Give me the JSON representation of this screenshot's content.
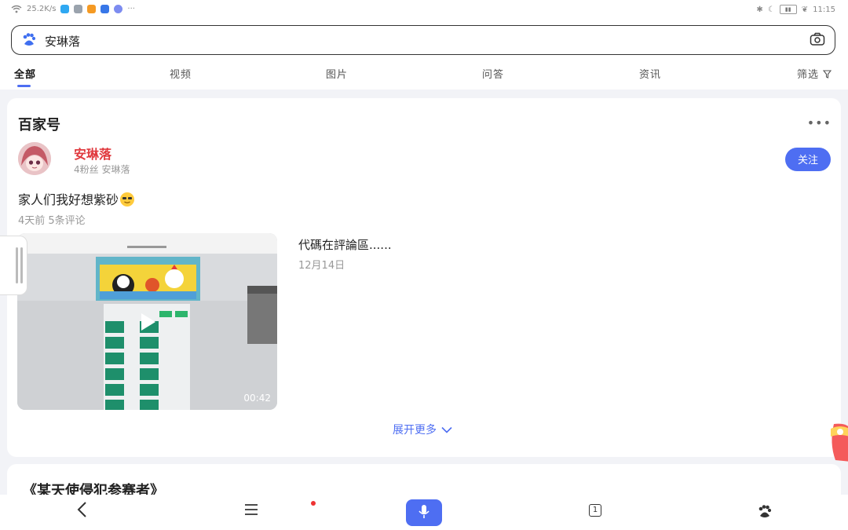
{
  "status": {
    "speed": "25.2K/s",
    "time": "11:15"
  },
  "search": {
    "query": "安琳落"
  },
  "tabs": [
    "全部",
    "视频",
    "图片",
    "问答",
    "资讯",
    "筛选"
  ],
  "card": {
    "section_title": "百家号",
    "author_name": "安琳落",
    "author_meta": "4粉丝  安琳落",
    "follow_label": "关注",
    "post_text": "家人们我好想紫砂",
    "post_meta": "4天前  5条评论",
    "video_duration": "00:42",
    "video_title": "代碼在評論區......",
    "video_date": "12月14日",
    "expand_label": "展开更多"
  },
  "next_card": {
    "title": "《某天使侵犯参赛者》"
  },
  "bottom_nav": {
    "tabs_count": "1"
  },
  "colors": {
    "accent": "#4e6ef2",
    "author": "#e0393e"
  }
}
